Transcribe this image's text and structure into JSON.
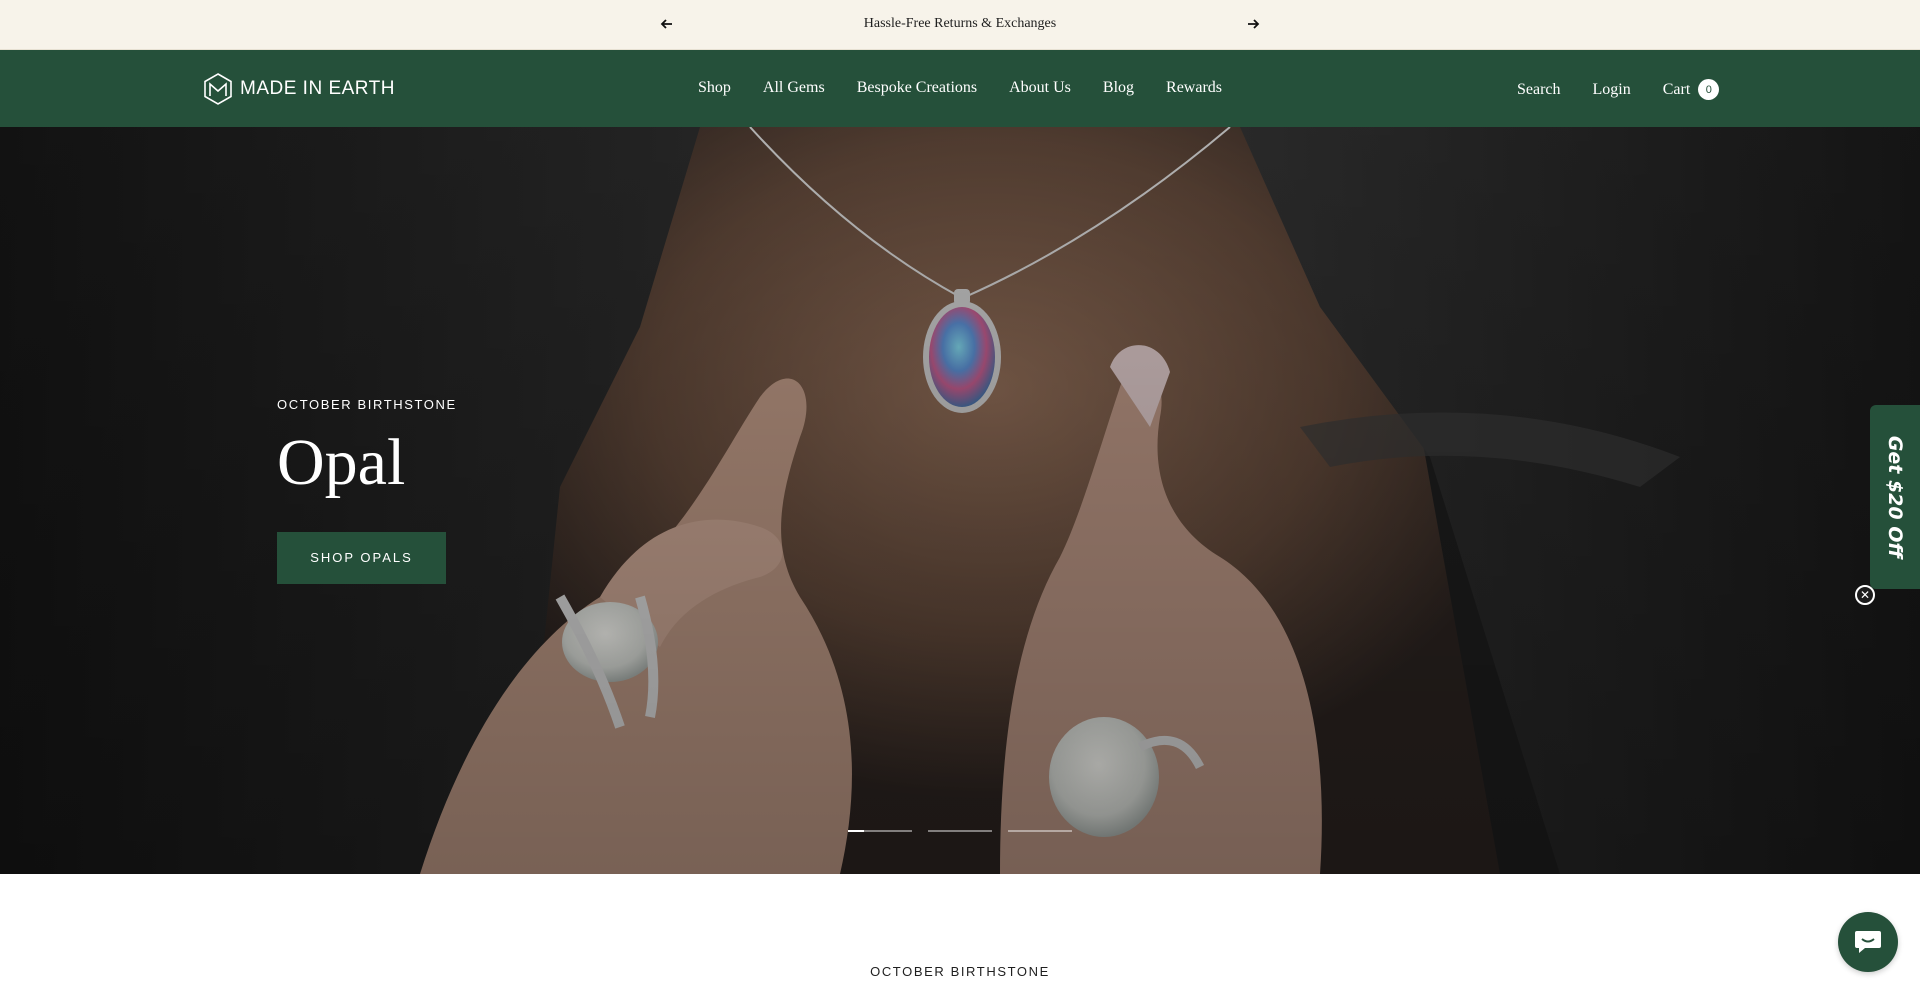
{
  "announcement": {
    "message": "Hassle-Free Returns & Exchanges",
    "prev_icon": "arrow-left-icon",
    "next_icon": "arrow-right-icon"
  },
  "header": {
    "logo_text": "MADE IN EARTH",
    "nav": [
      {
        "label": "Shop"
      },
      {
        "label": "All Gems"
      },
      {
        "label": "Bespoke Creations"
      },
      {
        "label": "About Us"
      },
      {
        "label": "Blog"
      },
      {
        "label": "Rewards"
      }
    ],
    "search_label": "Search",
    "login_label": "Login",
    "cart_label": "Cart",
    "cart_count": "0"
  },
  "hero": {
    "eyebrow": "OCTOBER BIRTHSTONE",
    "title": "Opal",
    "button_label": "SHOP OPALS",
    "slides": 3,
    "active_slide": 1
  },
  "promo": {
    "label": "Get $20 Off",
    "close_icon": "close-icon"
  },
  "section": {
    "eyebrow": "OCTOBER BIRTHSTONE"
  },
  "chat": {
    "icon": "chat-icon"
  },
  "colors": {
    "brand_green": "#25503a",
    "announcement_bg": "#f7f3ea"
  }
}
